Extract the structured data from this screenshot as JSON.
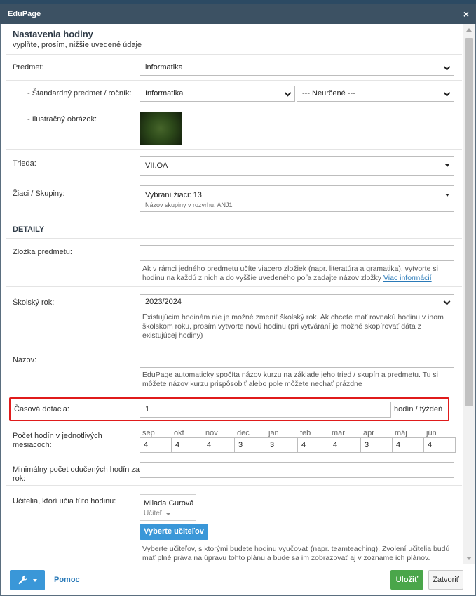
{
  "window": {
    "title": "EduPage",
    "close_glyph": "×"
  },
  "header": {
    "title": "Nastavenia hodiny",
    "subtitle": "vyplňte, prosím, nižšie uvedené údaje"
  },
  "form": {
    "predmet": {
      "label": "Predmet:",
      "value": "informatika"
    },
    "standard": {
      "label": "- Štandardný predmet / ročník:",
      "value": "Informatika",
      "grade_value": "--- Neurčené ---"
    },
    "ilustr": {
      "label": "- Ilustračný obrázok:"
    },
    "trieda": {
      "label": "Trieda:",
      "value": "VII.OA"
    },
    "ziaci": {
      "label": "Žiaci / Skupiny:",
      "value": "Vybraní žiaci: 13",
      "sub": "Názov skupiny v rozvrhu: ANJ1"
    },
    "section_detaily": "DETAILY",
    "zlozka": {
      "label": "Zložka predmetu:",
      "value": "",
      "help": "Ak v rámci jedného predmetu učíte viacero zložiek (napr. literatúra a gramatika), vytvorte si hodinu na každú z nich a do vyššie uvedeného poľa zadajte názov zložky",
      "help_link": "Viac informácií"
    },
    "skolsky_rok": {
      "label": "Školský rok:",
      "value": "2023/2024",
      "help": "Existujúcim hodinám nie je možné zmeniť školský rok. Ak chcete mať rovnakú hodinu v inom školskom roku, prosím vytvorte novú hodinu (pri vytváraní je možné skopírovať dáta z existujúcej hodiny)"
    },
    "nazov": {
      "label": "Názov:",
      "value": "",
      "help": "EduPage automaticky spočíta názov kurzu na základe jeho tried / skupín a predmetu. Tu si môžete názov kurzu prispôsobiť alebo pole môžete nechať prázdne"
    },
    "casova": {
      "label": "Časová dotácia:",
      "value": "1",
      "unit": "hodín / týždeň"
    },
    "pocet": {
      "label": "Počet hodín v jednotlivých mesiacoch:"
    },
    "months": [
      {
        "name": "sep",
        "value": "4"
      },
      {
        "name": "okt",
        "value": "4"
      },
      {
        "name": "nov",
        "value": "4"
      },
      {
        "name": "dec",
        "value": "3"
      },
      {
        "name": "jan",
        "value": "3"
      },
      {
        "name": "feb",
        "value": "4"
      },
      {
        "name": "mar",
        "value": "4"
      },
      {
        "name": "apr",
        "value": "3"
      },
      {
        "name": "máj",
        "value": "4"
      },
      {
        "name": "jún",
        "value": "4"
      }
    ],
    "min_pocet": {
      "label": "Minimálny počet odučených hodín za rok:",
      "value": ""
    },
    "ucitelia": {
      "label": "Učitelia, ktorí učia túto hodinu:",
      "teacher_name": "Milada Gurová",
      "teacher_role": "Učiteľ",
      "button": "Vyberte učiteľov",
      "help": "Vyberte učiteľov, s ktorými budete hodinu vyučovať (napr. teamteaching). Zvolení učitelia budú mať plné práva na úpravu tohto plánu a bude sa im zobrazovať aj v zozname ich plánov. Vyberte ďalších učiteľov, ak daný predmet v triede učíte viacerí učitelia, pričom sa na"
    }
  },
  "footer": {
    "help_label": "Pomoc",
    "save_label": "Uložiť",
    "close_label": "Zatvoriť"
  },
  "colors": {
    "titlebar": "#3c5163",
    "accent": "#3a97d8",
    "save": "#4aa64a",
    "highlight": "#e01b1b"
  }
}
